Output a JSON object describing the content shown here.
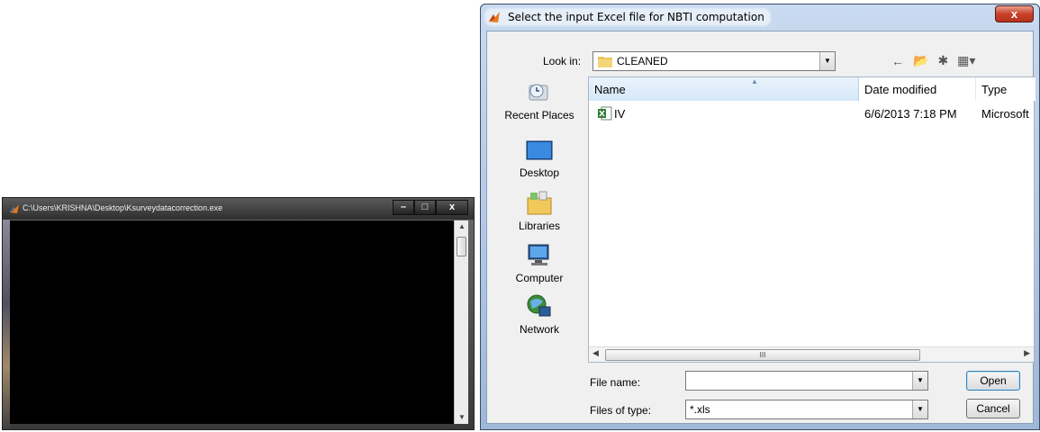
{
  "console": {
    "title": "C:\\Users\\KRISHNA\\Desktop\\Ksurveydatacorrection.exe",
    "buttons": {
      "minimize": "–",
      "maximize": "□",
      "close": "x"
    }
  },
  "dialog": {
    "title": "Select the input Excel file for NBTI computation",
    "close_label": "x",
    "look_in_label": "Look in:",
    "look_in_value": "CLEANED",
    "places": [
      {
        "label": "Recent Places",
        "icon": "recent-places-icon"
      },
      {
        "label": "Desktop",
        "icon": "desktop-icon"
      },
      {
        "label": "Libraries",
        "icon": "libraries-icon"
      },
      {
        "label": "Computer",
        "icon": "computer-icon"
      },
      {
        "label": "Network",
        "icon": "network-icon"
      }
    ],
    "columns": [
      "Name",
      "Date modified",
      "Type"
    ],
    "files": [
      {
        "name": "IV",
        "date_modified": "6/6/2013 7:18 PM",
        "type": "Microsoft",
        "icon": "excel-file-icon"
      }
    ],
    "scroll_grip": "III",
    "file_name_label": "File name:",
    "file_name_value": "",
    "file_type_label": "Files of type:",
    "file_type_value": "*.xls",
    "open_button": "Open",
    "cancel_button": "Cancel"
  }
}
